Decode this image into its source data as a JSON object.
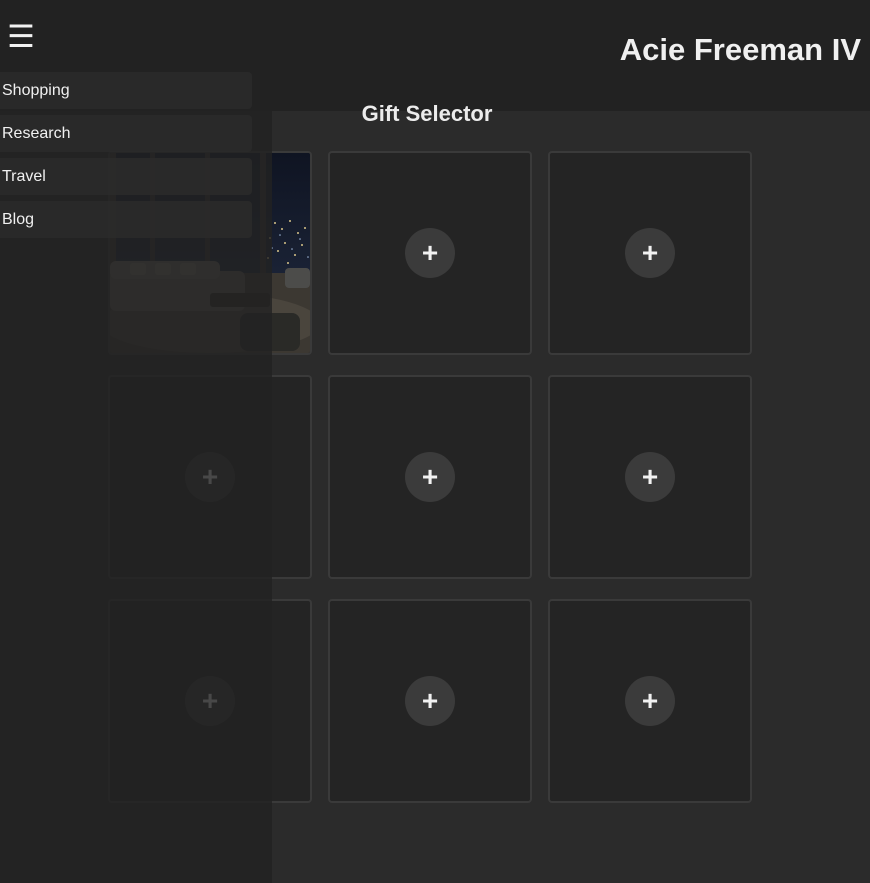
{
  "header": {
    "menu_icon": "hamburger-menu-icon",
    "menu_glyph": "☰",
    "user_name": "Acie Freeman IV"
  },
  "page": {
    "title": "Gift Selector"
  },
  "sidebar": {
    "items": [
      {
        "label": "Shopping"
      },
      {
        "label": "Research"
      },
      {
        "label": "Travel"
      },
      {
        "label": "Blog"
      }
    ]
  },
  "tiles": {
    "add_glyph": "+",
    "add_icon": "plus-icon",
    "photo_tile_image": "night-city-living-room-photo"
  },
  "colors": {
    "background": "#2b2b2b",
    "header": "#222222",
    "tile": "#242424",
    "tile_border": "#3a3a3a",
    "add_button": "#3b3b3b",
    "text": "#ececec"
  }
}
